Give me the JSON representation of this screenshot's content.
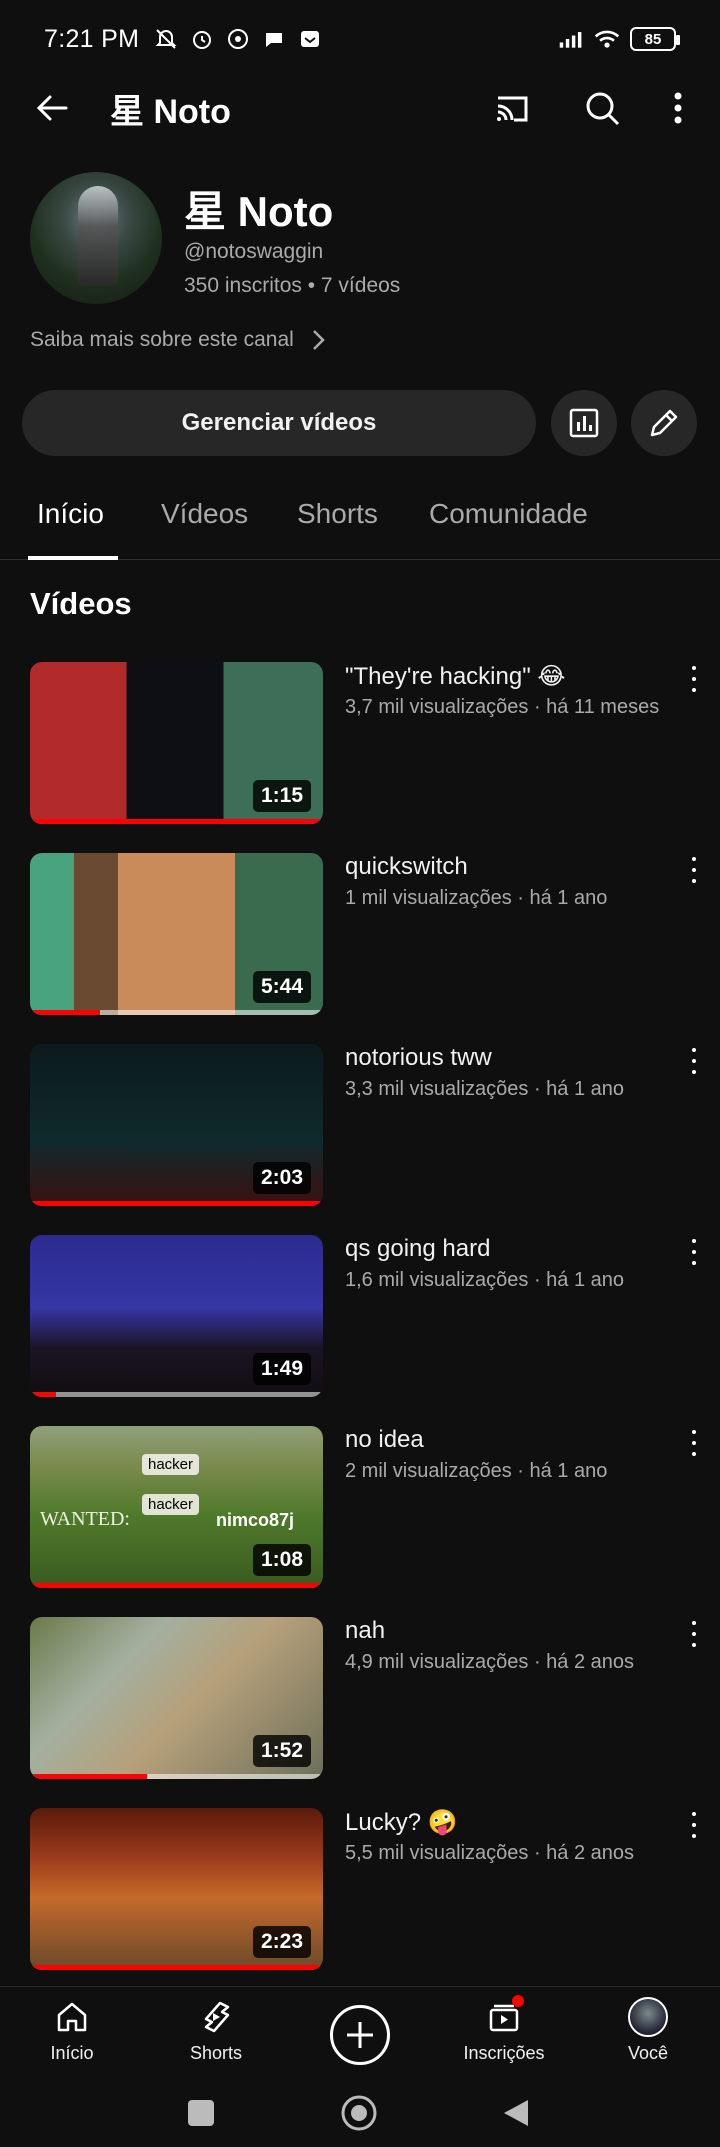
{
  "status_bar": {
    "time": "7:21 PM",
    "battery": "85"
  },
  "app_bar": {
    "title": "星 Noto"
  },
  "channel": {
    "name": "星 Noto",
    "handle": "@notoswaggin",
    "meta": "350 inscritos • 7 vídeos",
    "more_link": "Saiba mais sobre este canal",
    "manage_button": "Gerenciar vídeos"
  },
  "tabs": [
    "Início",
    "Vídeos",
    "Shorts",
    "Comunidade"
  ],
  "section_title": "Vídeos",
  "videos": [
    {
      "title": "\"They're hacking\" 😂",
      "meta": "3,7 mil visualizações · há 11 meses",
      "duration": "1:15",
      "progress": 1.0
    },
    {
      "title": "quickswitch",
      "meta": "1 mil visualizações · há 1 ano",
      "duration": "5:44",
      "progress": 0.24
    },
    {
      "title": "notorious tww",
      "meta": "3,3 mil visualizações · há 1 ano",
      "duration": "2:03",
      "progress": 1.0
    },
    {
      "title": "qs going hard",
      "meta": "1,6 mil visualizações · há 1 ano",
      "duration": "1:49",
      "progress": 0.09
    },
    {
      "title": "no idea",
      "meta": "2 mil visualizações · há 1 ano",
      "duration": "1:08",
      "progress": 1.0,
      "thumb_labels": {
        "tag1": "hacker",
        "tag2": "hacker",
        "wanted": "WANTED:",
        "nick": "nimco87j"
      }
    },
    {
      "title": "nah",
      "meta": "4,9 mil visualizações · há 2 anos",
      "duration": "1:52",
      "progress": 0.4
    },
    {
      "title": "Lucky? 🤪",
      "meta": "5,5 mil visualizações · há 2 anos",
      "duration": "2:23",
      "progress": 1.0
    }
  ],
  "bottom_nav": {
    "home": "Início",
    "shorts": "Shorts",
    "subscriptions": "Inscrições",
    "you": "Você"
  },
  "colors": {
    "background": "#0f0f0f",
    "accent": "#ff0000",
    "secondary_text": "#aaaaaa",
    "chip": "#272727"
  }
}
